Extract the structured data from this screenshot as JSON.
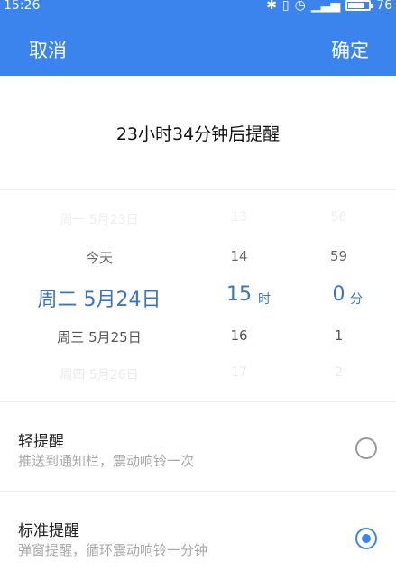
{
  "status_bar": {
    "time": "15:26",
    "battery": "76"
  },
  "header": {
    "cancel_label": "取消",
    "confirm_label": "确定",
    "accent_color": "#3b84ee"
  },
  "summary": {
    "text": "23小时34分钟后提醒"
  },
  "picker": {
    "day": [
      "周一 5月23日",
      "今天",
      "周二 5月24日",
      "周三 5月25日",
      "周四 5月26日"
    ],
    "hour": [
      "13",
      "14",
      "15",
      "16",
      "17"
    ],
    "minute": [
      "58",
      "59",
      "0",
      "1",
      "2"
    ],
    "hour_unit": "时",
    "minute_unit": "分"
  },
  "options": [
    {
      "title": "轻提醒",
      "subtitle": "推送到通知栏，震动响铃一次",
      "selected": false
    },
    {
      "title": "标准提醒",
      "subtitle": "弹窗提醒，循环震动响铃一分钟",
      "selected": true
    }
  ]
}
